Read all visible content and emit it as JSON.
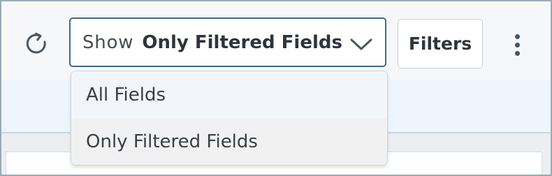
{
  "toolbar": {
    "refresh_icon": "refresh-icon",
    "field_select": {
      "prefix": "Show",
      "value": "Only Filtered Fields",
      "icon": "chevron-down-icon"
    },
    "filters_label": "Filters",
    "more_icon": "more-vertical-icon"
  },
  "dropdown": {
    "options": [
      {
        "label": "All Fields",
        "selected": false
      },
      {
        "label": "Only Filtered Fields",
        "selected": true
      }
    ]
  },
  "colors": {
    "select_border": "#40698d",
    "dropdown_hover": "#f2f6fb",
    "selected_option": "#f1f1f1",
    "band_bg": "#eef5fd"
  }
}
